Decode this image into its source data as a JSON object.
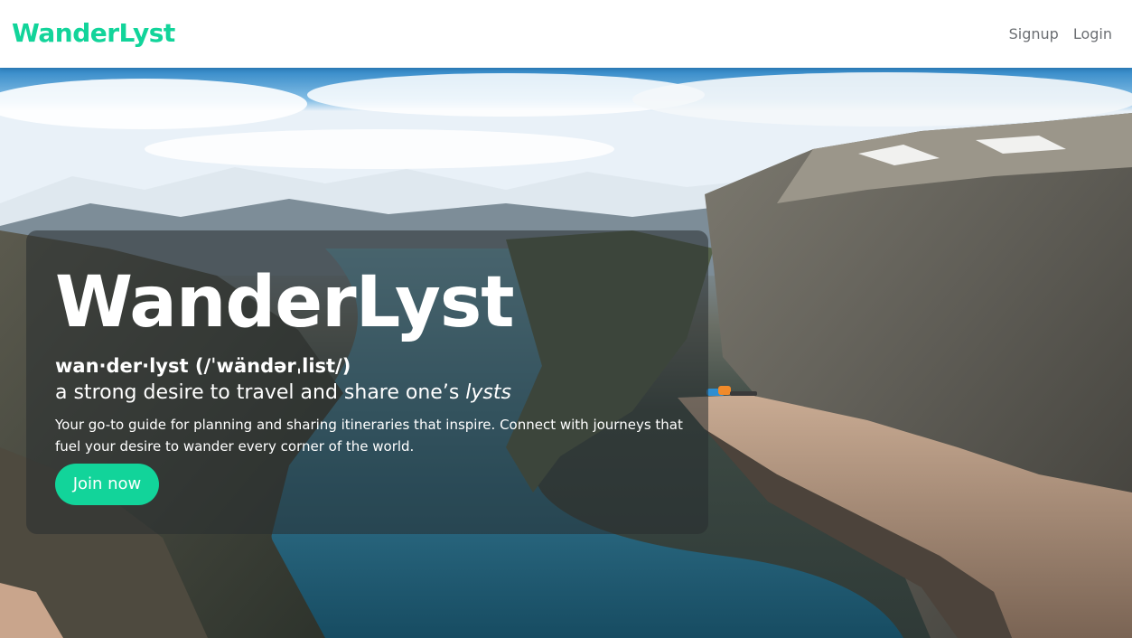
{
  "navbar": {
    "brand": "WanderLyst",
    "links": [
      {
        "label": "Signup"
      },
      {
        "label": "Login"
      }
    ]
  },
  "hero": {
    "title": "WanderLyst",
    "pronunciation": "wan·der·lyst (/ˈwändərˌlist/)",
    "definition_prefix": "a strong desire to travel and share one’s ",
    "definition_emphasis": "lysts",
    "description": "Your go-to guide for planning and sharing itineraries that inspire. Connect with journeys that fuel your desire to wander every corner of the world.",
    "cta_label": "Join now"
  },
  "colors": {
    "brand_green": "#12d49a",
    "nav_link": "#6c6f73",
    "card_overlay": "rgba(40, 46, 48, 0.55)"
  }
}
